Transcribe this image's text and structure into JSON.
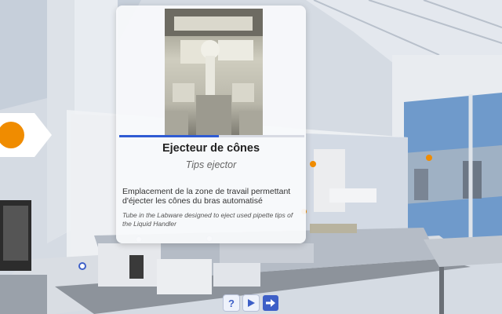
{
  "info_card": {
    "title": "Ejecteur de cônes",
    "subtitle": "Tips ejector",
    "description_fr": "Emplacement de la zone de travail permettant d'éjecter les cônes du bras automatisé",
    "description_en": "Tube in the Labware designed to eject used pipette tips of the Liquid Handler",
    "progress": 0.54
  },
  "controls": {
    "help_label": "?",
    "help_icon": "question-icon",
    "play_icon": "play-icon",
    "next_icon": "arrow-right-icon"
  },
  "colors": {
    "accent": "#3d5fc7",
    "marker": "#f08c00",
    "progress": "#2f5bd3"
  }
}
